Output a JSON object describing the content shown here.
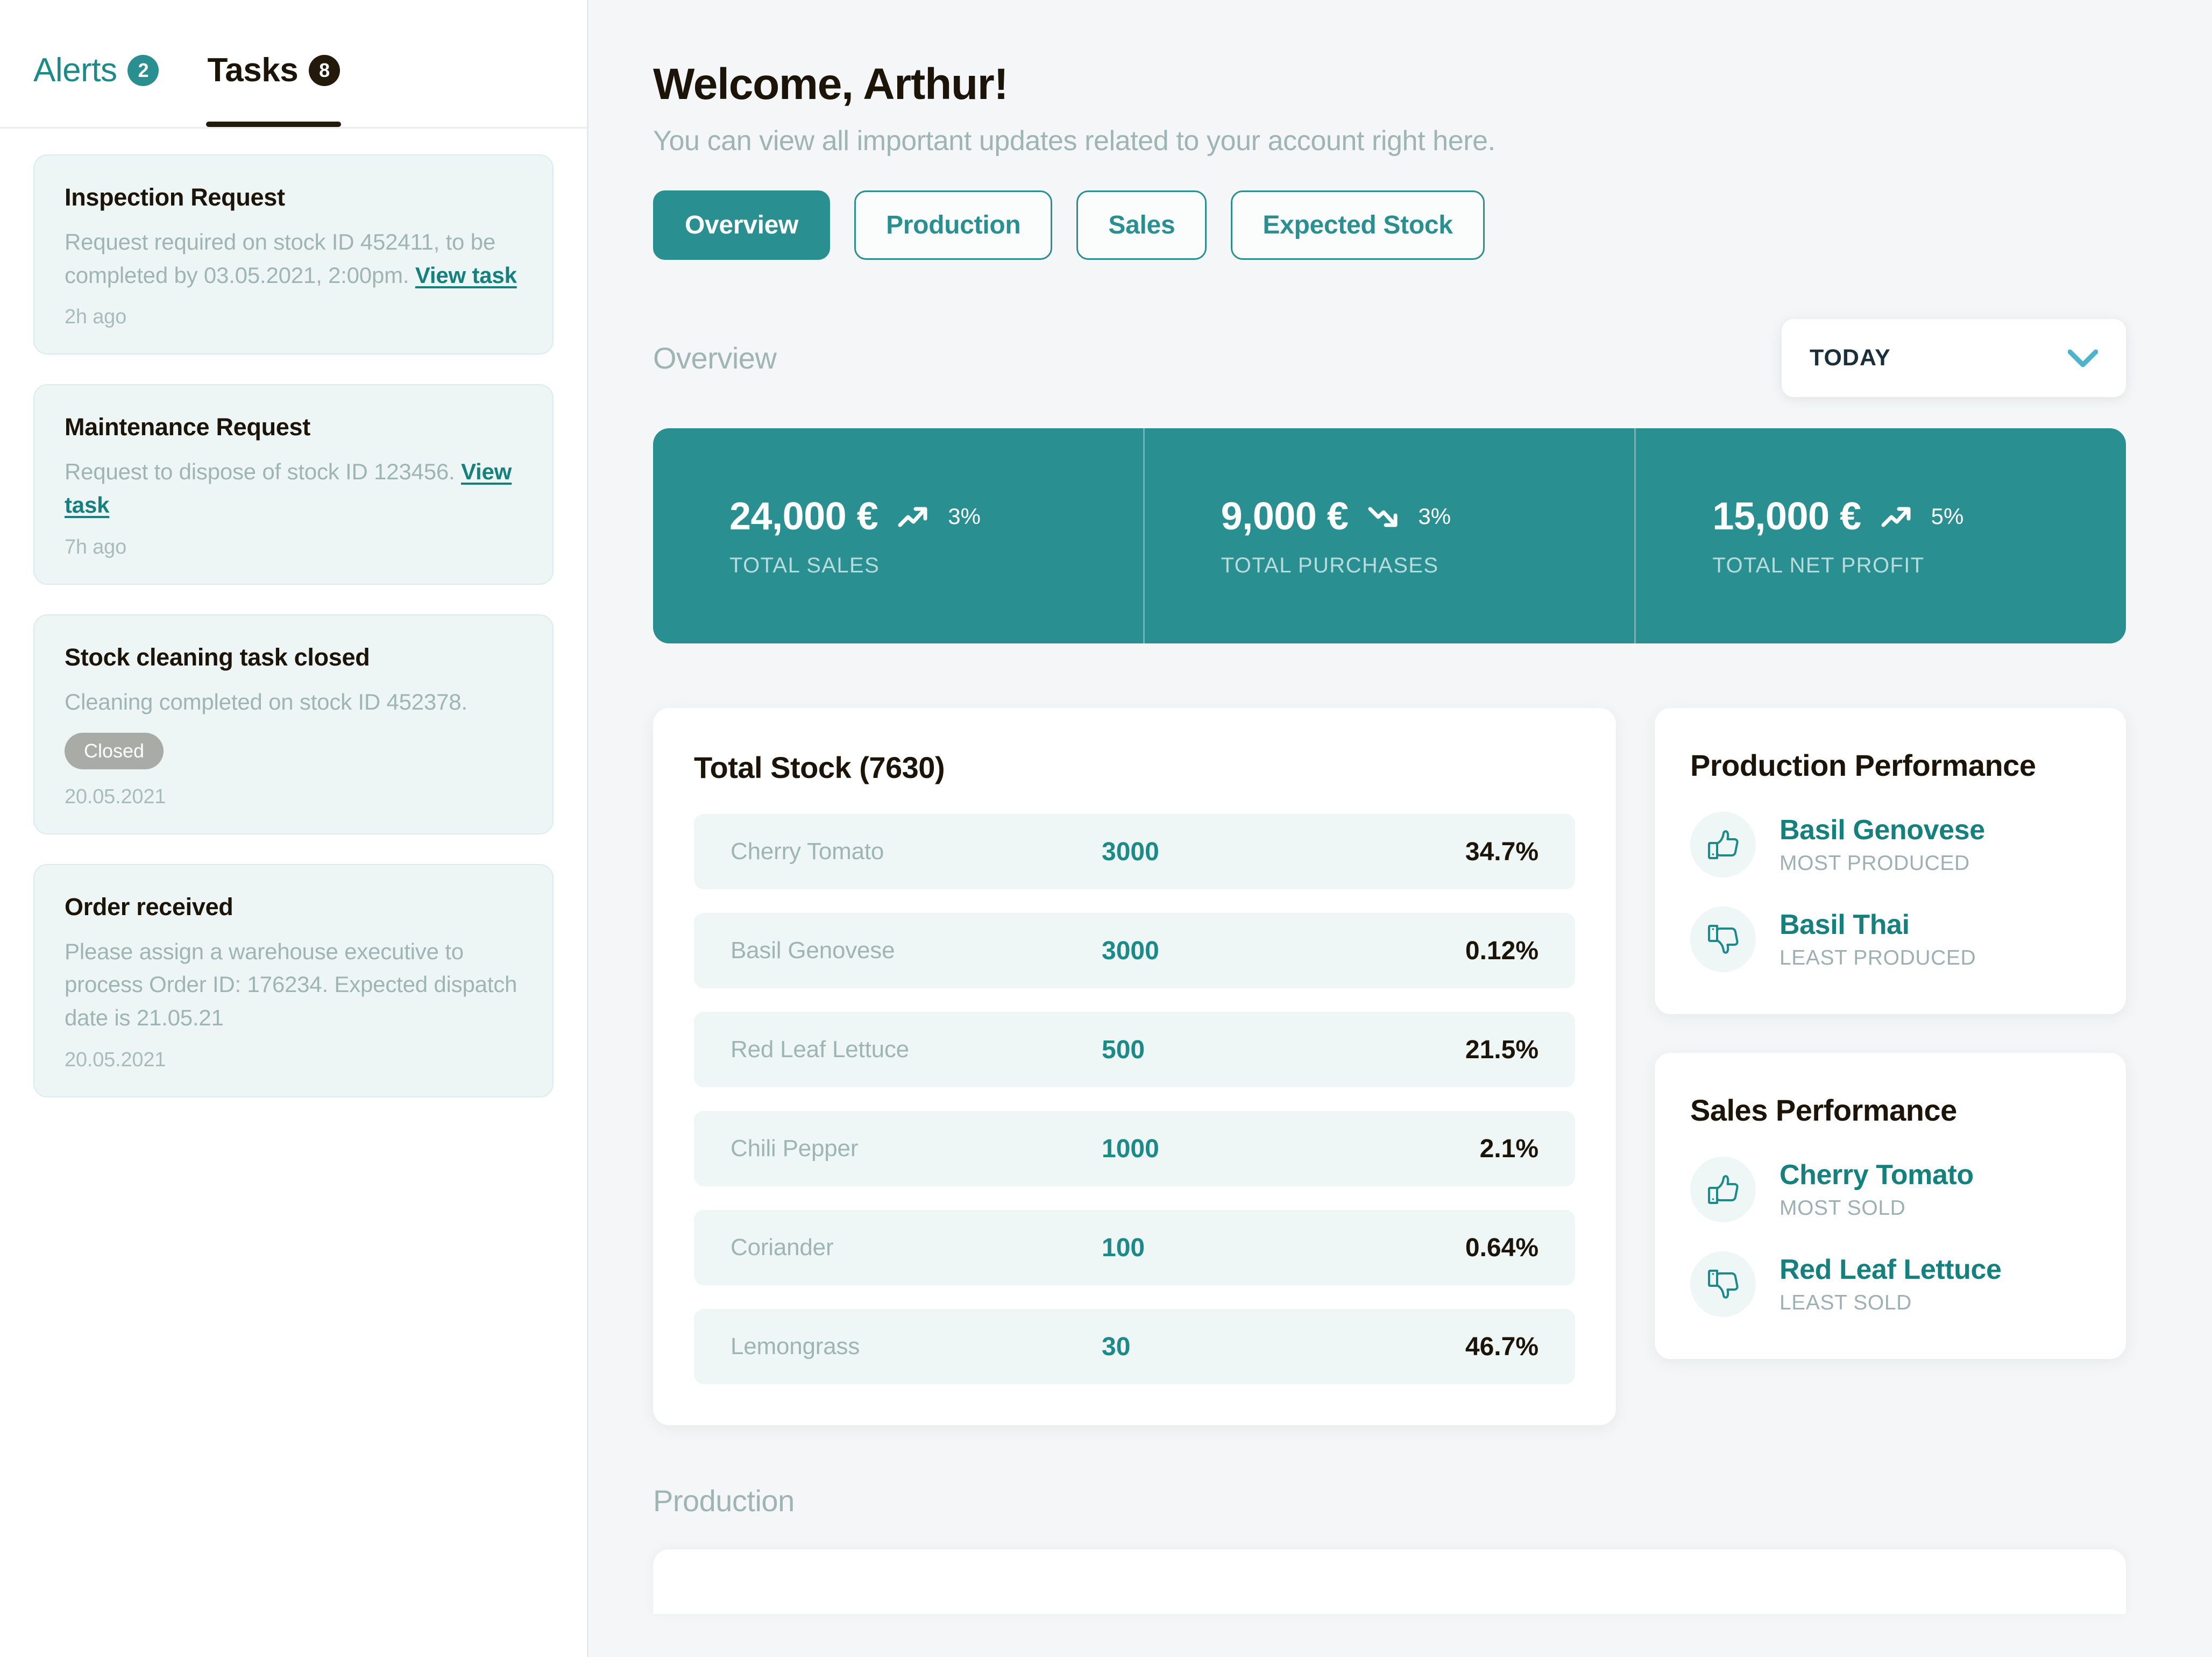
{
  "sidebar": {
    "tabs": [
      {
        "label": "Alerts",
        "count": "2",
        "active": false
      },
      {
        "label": "Tasks",
        "count": "8",
        "active": true
      }
    ],
    "tasks": [
      {
        "title": "Inspection Request",
        "body_before": "Request required on stock ID 452411, to be completed by 03.05.2021, 2:00pm. ",
        "link": "View task",
        "body_after": "",
        "status": "",
        "time": "2h ago"
      },
      {
        "title": "Maintenance Request",
        "body_before": "Request to dispose of stock ID 123456. ",
        "link": "View task",
        "body_after": "",
        "status": "",
        "time": "7h ago"
      },
      {
        "title": "Stock cleaning task closed",
        "body_before": "Cleaning completed on stock ID 452378.",
        "link": "",
        "body_after": "",
        "status": "Closed",
        "time": "20.05.2021"
      },
      {
        "title": "Order received",
        "body_before": "Please assign a warehouse executive to process Order ID: 176234. Expected dispatch date is 21.05.21",
        "link": "",
        "body_after": "",
        "status": "",
        "time": "20.05.2021"
      }
    ]
  },
  "main": {
    "title": "Welcome, Arthur!",
    "subtitle": "You can view all important updates related to your account right here.",
    "nav_tabs": [
      {
        "label": "Overview",
        "active": true
      },
      {
        "label": "Production",
        "active": false
      },
      {
        "label": "Sales",
        "active": false
      },
      {
        "label": "Expected Stock",
        "active": false
      }
    ],
    "overview_heading": "Overview",
    "period": {
      "value": "TODAY",
      "icon": "chevron-down-icon"
    },
    "stats": [
      {
        "value": "24,000 €",
        "delta": "3%",
        "trend": "up",
        "label": "TOTAL SALES"
      },
      {
        "value": "9,000 €",
        "delta": "3%",
        "trend": "down",
        "label": "TOTAL PURCHASES"
      },
      {
        "value": "15,000 €",
        "delta": "5%",
        "trend": "up",
        "label": "TOTAL NET PROFIT"
      }
    ],
    "stock": {
      "title": "Total Stock (7630)",
      "rows": [
        {
          "name": "Cherry Tomato",
          "qty": "3000",
          "pct": "34.7%"
        },
        {
          "name": "Basil Genovese",
          "qty": "3000",
          "pct": "0.12%"
        },
        {
          "name": "Red Leaf Lettuce",
          "qty": "500",
          "pct": "21.5%"
        },
        {
          "name": "Chili Pepper",
          "qty": "1000",
          "pct": "2.1%"
        },
        {
          "name": "Coriander",
          "qty": "100",
          "pct": "0.64%"
        },
        {
          "name": "Lemongrass",
          "qty": "30",
          "pct": "46.7%"
        }
      ]
    },
    "production_performance": {
      "title": "Production Performance",
      "best": {
        "name": "Basil Genovese",
        "label": "MOST PRODUCED",
        "icon": "thumbs-up-icon"
      },
      "worst": {
        "name": "Basil Thai",
        "label": "LEAST PRODUCED",
        "icon": "thumbs-down-icon"
      }
    },
    "sales_performance": {
      "title": "Sales Performance",
      "best": {
        "name": "Cherry Tomato",
        "label": "MOST SOLD",
        "icon": "thumbs-up-icon"
      },
      "worst": {
        "name": "Red Leaf Lettuce",
        "label": "LEAST SOLD",
        "icon": "thumbs-down-icon"
      }
    },
    "production_heading": "Production"
  },
  "colors": {
    "accent_teal": "#2a8f91",
    "link_teal": "#15807e",
    "muted": "#9fb5b4",
    "dark": "#1c1408",
    "card_bg": "#ffffff",
    "page_bg": "#f4f6f7",
    "row_bg": "#eef7f5",
    "pill_gray": "#a9aca6",
    "chevron_blue": "#4eb3cd"
  }
}
